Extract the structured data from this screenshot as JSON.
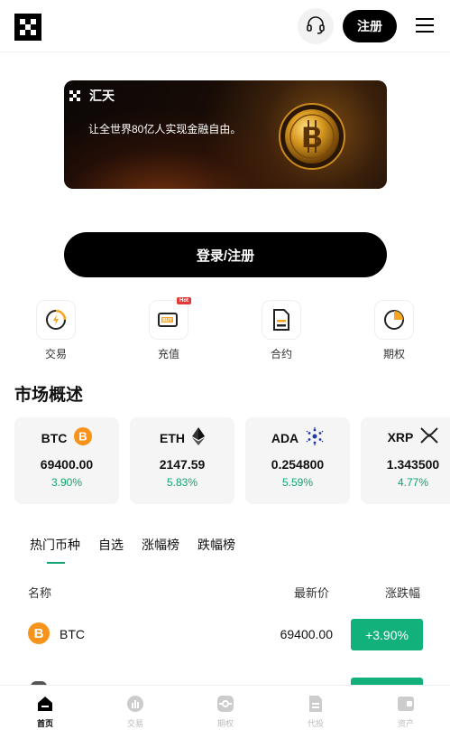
{
  "header": {
    "logo_icon": "okx-logo-icon",
    "support_icon": "headset-icon",
    "signup_label": "注册",
    "menu_icon": "hamburger-menu-icon"
  },
  "banner": {
    "brand": "汇天",
    "text": "让全世界80亿人实现金融自由。",
    "image_icon": "bitcoin-coin-icon"
  },
  "login_button": "登录/注册",
  "shortcuts": [
    {
      "label": "交易",
      "icon": "exchange-icon"
    },
    {
      "label": "充值",
      "icon": "deposit-buy-icon",
      "badge": "Hot"
    },
    {
      "label": "合约",
      "icon": "contract-document-icon"
    },
    {
      "label": "期权",
      "icon": "pie-chart-icon"
    }
  ],
  "market": {
    "title": "市场概述",
    "cards": [
      {
        "symbol": "BTC",
        "price": "69400.00",
        "change": "3.90%",
        "icon": "btc-icon"
      },
      {
        "symbol": "ETH",
        "price": "2147.59",
        "change": "5.83%",
        "icon": "eth-icon"
      },
      {
        "symbol": "ADA",
        "price": "0.254800",
        "change": "5.59%",
        "icon": "ada-icon"
      },
      {
        "symbol": "XRP",
        "price": "1.343500",
        "change": "4.77%",
        "icon": "xrp-icon"
      }
    ]
  },
  "tabs": [
    "热门币种",
    "自选",
    "涨幅榜",
    "跌幅榜"
  ],
  "table": {
    "headers": [
      "名称",
      "最新价",
      "涨跌幅"
    ],
    "rows": [
      {
        "name": "BTC",
        "price": "69400.00",
        "change": "+3.90%"
      }
    ]
  },
  "bottom_nav": [
    {
      "label": "首页",
      "icon": "home-icon"
    },
    {
      "label": "交易",
      "icon": "trade-icon"
    },
    {
      "label": "期权",
      "icon": "options-icon"
    },
    {
      "label": "代投",
      "icon": "copy-trade-icon"
    },
    {
      "label": "资产",
      "icon": "wallet-icon"
    }
  ],
  "colors": {
    "accent_green": "#12b07a",
    "primary_black": "#000000",
    "btc_orange": "#f7931a"
  }
}
